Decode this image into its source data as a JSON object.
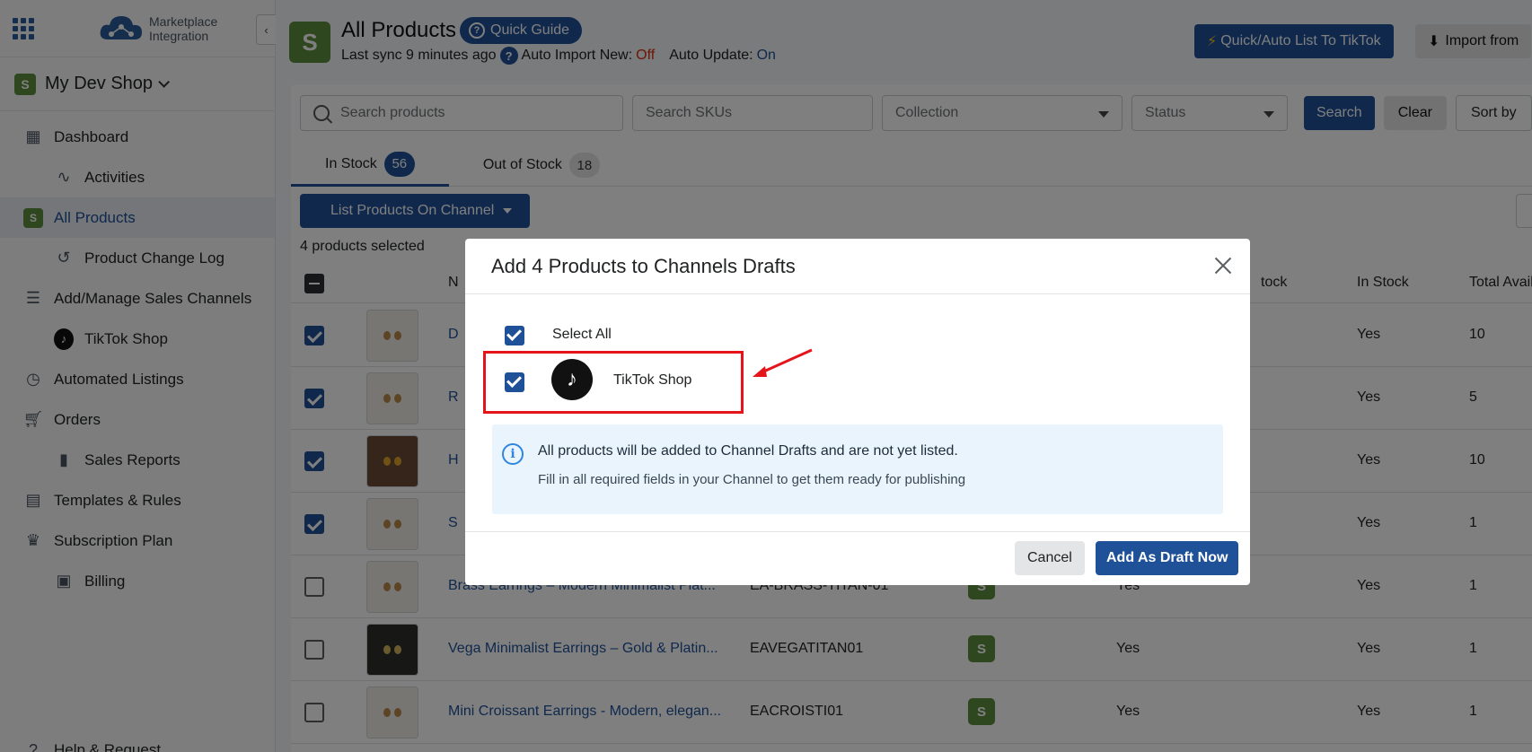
{
  "sidebar": {
    "logo_line1": "Marketplace",
    "logo_line2": "Integration",
    "collapse_glyph": "‹",
    "shop_name": "My Dev Shop",
    "items": [
      {
        "label": "Dashboard",
        "icon": "dashboard-icon"
      },
      {
        "label": "Activities",
        "icon": "activity-icon"
      },
      {
        "label": "All Products",
        "icon": "shopify-bag-icon"
      },
      {
        "label": "Product Change Log",
        "icon": "history-icon"
      },
      {
        "label": "Add/Manage Sales Channels",
        "icon": "list-icon"
      },
      {
        "label": "TikTok Shop",
        "icon": "tiktok-icon"
      },
      {
        "label": "Automated Listings",
        "icon": "clock-icon"
      },
      {
        "label": "Orders",
        "icon": "cart-icon"
      },
      {
        "label": "Sales Reports",
        "icon": "bar-chart-icon"
      },
      {
        "label": "Templates & Rules",
        "icon": "document-icon"
      },
      {
        "label": "Subscription Plan",
        "icon": "crown-icon"
      },
      {
        "label": "Billing",
        "icon": "wallet-icon"
      }
    ]
  },
  "header": {
    "title": "All Products",
    "quick_guide": "Quick Guide",
    "sync_text": "Last sync 9 minutes ago",
    "auto_import_label": "Auto Import New:",
    "auto_import_value": "Off",
    "auto_update_label": "Auto Update:",
    "auto_update_value": "On",
    "quick_list_btn": "Quick/Auto List To TikTok",
    "import_btn": "Import from"
  },
  "filters": {
    "search_products": "Search products",
    "search_skus": "Search SKUs",
    "collection": "Collection",
    "status": "Status",
    "search_btn": "Search",
    "clear_btn": "Clear",
    "sort_btn": "Sort by"
  },
  "tabs": [
    {
      "label": "In Stock",
      "count": "56"
    },
    {
      "label": "Out of Stock",
      "count": "18"
    }
  ],
  "list_btn": "List Products On Channel",
  "selected_text": "4 products selected",
  "table": {
    "headers": {
      "name": "N",
      "channel_stock": "tock",
      "in_stock": "In Stock",
      "total": "Total Availab"
    },
    "rows": [
      {
        "name": "D",
        "sku": "",
        "yes1": "",
        "in_stock": "Yes",
        "total": "10",
        "checked": true
      },
      {
        "name": "R",
        "sku": "",
        "yes1": "",
        "in_stock": "Yes",
        "total": "5",
        "checked": true
      },
      {
        "name": "H",
        "sku": "",
        "yes1": "",
        "in_stock": "Yes",
        "total": "10",
        "checked": true
      },
      {
        "name": "S",
        "sku": "",
        "yes1": "",
        "in_stock": "Yes",
        "total": "1",
        "checked": true
      },
      {
        "name": "Brass Earrings – Modern Minimalist Plat...",
        "sku": "EA-BRASS-TITAN-01",
        "yes1": "Yes",
        "in_stock": "Yes",
        "total": "1",
        "checked": false
      },
      {
        "name": "Vega Minimalist Earrings – Gold & Platin...",
        "sku": "EAVEGATITAN01",
        "yes1": "Yes",
        "in_stock": "Yes",
        "total": "1",
        "checked": false
      },
      {
        "name": "Mini Croissant Earrings - Modern, elegan...",
        "sku": "EACROISTI01",
        "yes1": "Yes",
        "in_stock": "Yes",
        "total": "1",
        "checked": false
      }
    ]
  },
  "help_partial": "Help & Request",
  "modal": {
    "title": "Add 4 Products to Channels Drafts",
    "select_all": "Select All",
    "channel_name": "TikTok Shop",
    "info_title": "All products will be added to Channel Drafts and are not yet listed.",
    "info_body": "Fill in all required fields in your Channel to get them ready for publishing",
    "cancel": "Cancel",
    "add": "Add As Draft Now"
  },
  "colors": {
    "primary": "#1f5199",
    "shopify_green": "#5e8e3e",
    "highlight_red": "#e5141b",
    "off_red": "#d82c0d"
  }
}
